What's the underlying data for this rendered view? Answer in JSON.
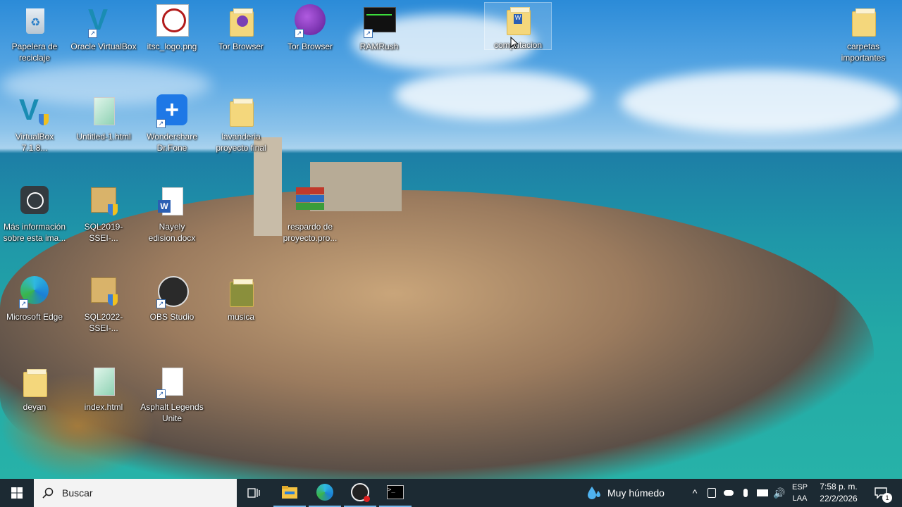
{
  "desktop_icons": [
    {
      "label": "Papelera de reciclaje"
    },
    {
      "label": "Oracle VirtualBox"
    },
    {
      "label": "itsc_logo.png"
    },
    {
      "label": "Tor Browser"
    },
    {
      "label": "Tor Browser"
    },
    {
      "label": "RAMRush"
    },
    {
      "label": "computacion"
    },
    {
      "label": "carpetas importantes"
    },
    {
      "label": "VirtualBox 7.1.8..."
    },
    {
      "label": "Untitled-1.html"
    },
    {
      "label": "Wondershare Dr.Fone"
    },
    {
      "label": "lavanderia proyecto final"
    },
    {
      "label": "Más información sobre esta ima..."
    },
    {
      "label": "SQL2019-SSEI-..."
    },
    {
      "label": "Nayely edision.docx"
    },
    {
      "label": "respardo de proyecto.pro..."
    },
    {
      "label": "Microsoft Edge"
    },
    {
      "label": "SQL2022-SSEI-..."
    },
    {
      "label": "OBS Studio"
    },
    {
      "label": "musica"
    },
    {
      "label": "deyan"
    },
    {
      "label": "index.html"
    },
    {
      "label": "Asphalt Legends Unite"
    }
  ],
  "taskbar": {
    "search_placeholder": "Buscar",
    "weather_text": "Muy húmedo",
    "language_top": "ESP",
    "language_bottom": "LAA",
    "time": "7:58 p. m.",
    "date": "22/2/2026",
    "notification_count": "1"
  },
  "colors": {
    "taskbar": "#1c2a33",
    "search_bg": "#f3f3f3",
    "accent": "#0078d4"
  }
}
